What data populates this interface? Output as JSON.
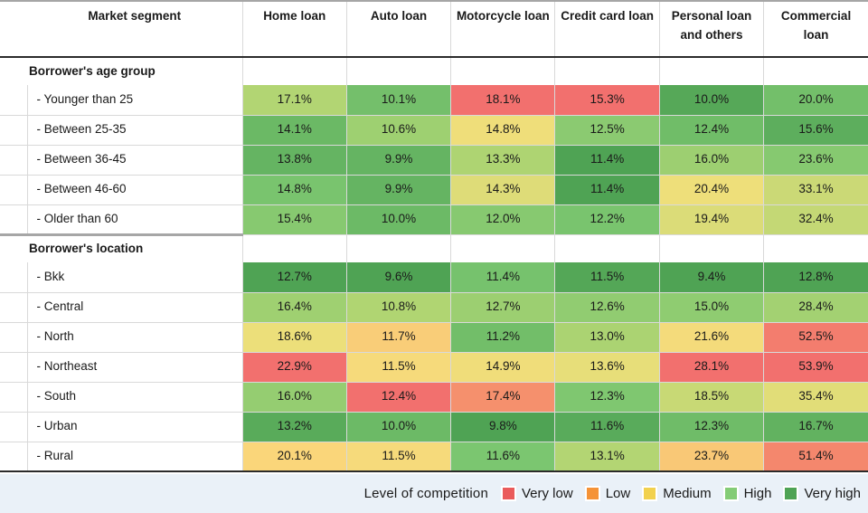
{
  "table": {
    "columns": [
      "Market segment",
      "Home loan",
      "Auto loan",
      "Motorcycle loan",
      "Credit card loan",
      "Personal loan and others",
      "Commercial loan"
    ],
    "sections": [
      {
        "title": "Borrower's age group",
        "rows": [
          {
            "label": "- Younger than 25",
            "values": [
              "17.1%",
              "10.1%",
              "18.1%",
              "15.3%",
              "10.0%",
              "20.0%"
            ]
          },
          {
            "label": "- Between 25-35",
            "values": [
              "14.1%",
              "10.6%",
              "14.8%",
              "12.5%",
              "12.4%",
              "15.6%"
            ]
          },
          {
            "label": "- Between 36-45",
            "values": [
              "13.8%",
              "9.9%",
              "13.3%",
              "11.4%",
              "16.0%",
              "23.6%"
            ]
          },
          {
            "label": "- Between 46-60",
            "values": [
              "14.8%",
              "9.9%",
              "14.3%",
              "11.4%",
              "20.4%",
              "33.1%"
            ]
          },
          {
            "label": "- Older than 60",
            "values": [
              "15.4%",
              "10.0%",
              "12.0%",
              "12.2%",
              "19.4%",
              "32.4%"
            ]
          }
        ]
      },
      {
        "title": "Borrower's location",
        "rows": [
          {
            "label": "- Bkk",
            "values": [
              "12.7%",
              "9.6%",
              "11.4%",
              "11.5%",
              "9.4%",
              "12.8%"
            ]
          },
          {
            "label": "- Central",
            "values": [
              "16.4%",
              "10.8%",
              "12.7%",
              "12.6%",
              "15.0%",
              "28.4%"
            ]
          },
          {
            "label": "- North",
            "values": [
              "18.6%",
              "11.7%",
              "11.2%",
              "13.0%",
              "21.6%",
              "52.5%"
            ]
          },
          {
            "label": "- Northeast",
            "values": [
              "22.9%",
              "11.5%",
              "14.9%",
              "13.6%",
              "28.1%",
              "53.9%"
            ]
          },
          {
            "label": "- South",
            "values": [
              "16.0%",
              "12.4%",
              "17.4%",
              "12.3%",
              "18.5%",
              "35.4%"
            ]
          },
          {
            "label": "- Urban",
            "values": [
              "13.2%",
              "10.0%",
              "9.8%",
              "11.6%",
              "12.3%",
              "16.7%"
            ]
          },
          {
            "label": "- Rural",
            "values": [
              "20.1%",
              "11.5%",
              "11.6%",
              "13.1%",
              "23.7%",
              "51.4%"
            ]
          }
        ]
      }
    ]
  },
  "chart_data": {
    "type": "heatmap",
    "title": "",
    "xlabel": "",
    "ylabel": "",
    "grid": true,
    "x_categories": [
      "Home loan",
      "Auto loan",
      "Motorcycle loan",
      "Credit card loan",
      "Personal loan and others",
      "Commercial loan"
    ],
    "y_categories": [
      "- Younger than 25",
      "- Between 25-35",
      "- Between 36-45",
      "- Between 46-60",
      "- Older than 60",
      "- Bkk",
      "- Central",
      "- North",
      "- Northeast",
      "- South",
      "- Urban",
      "- Rural"
    ],
    "y_groups": [
      {
        "name": "Borrower's age group",
        "members": [
          "- Younger than 25",
          "- Between 25-35",
          "- Between 36-45",
          "- Between 46-60",
          "- Older than 60"
        ]
      },
      {
        "name": "Borrower's location",
        "members": [
          "- Bkk",
          "- Central",
          "- North",
          "- Northeast",
          "- South",
          "- Urban",
          "- Rural"
        ]
      }
    ],
    "unit": "percent",
    "values": [
      [
        17.1,
        10.1,
        18.1,
        15.3,
        10.0,
        20.0
      ],
      [
        14.1,
        10.6,
        14.8,
        12.5,
        12.4,
        15.6
      ],
      [
        13.8,
        9.9,
        13.3,
        11.4,
        16.0,
        23.6
      ],
      [
        14.8,
        9.9,
        14.3,
        11.4,
        20.4,
        33.1
      ],
      [
        15.4,
        10.0,
        12.0,
        12.2,
        19.4,
        32.4
      ],
      [
        12.7,
        9.6,
        11.4,
        11.5,
        9.4,
        12.8
      ],
      [
        16.4,
        10.8,
        12.7,
        12.6,
        15.0,
        28.4
      ],
      [
        18.6,
        11.7,
        11.2,
        13.0,
        21.6,
        52.5
      ],
      [
        22.9,
        11.5,
        14.9,
        13.6,
        28.1,
        53.9
      ],
      [
        16.0,
        12.4,
        17.4,
        12.3,
        18.5,
        35.4
      ],
      [
        13.2,
        10.0,
        9.8,
        11.6,
        12.3,
        16.7
      ],
      [
        20.1,
        11.5,
        11.6,
        13.1,
        23.7,
        51.4
      ]
    ],
    "colorscale": {
      "direction": "low value = green (very high competition), high value = red (very low competition)",
      "normalization": "per-column min/max",
      "stops": [
        "#f2706e",
        "#f79c5e",
        "#f7d56b",
        "#a8d26d",
        "#4fa354"
      ]
    },
    "legend": {
      "position": "bottom-right",
      "title": "Level of competition",
      "entries": [
        {
          "label": "Very low",
          "color": "#ea5b5b"
        },
        {
          "label": "Low",
          "color": "#f59337"
        },
        {
          "label": "Medium",
          "color": "#f2d14e"
        },
        {
          "label": "High",
          "color": "#84cc76"
        },
        {
          "label": "Very high",
          "color": "#4fa354"
        }
      ]
    }
  },
  "legend": {
    "title": "Level of competition",
    "items": [
      {
        "label": "Very low",
        "color": "#ea5b5b"
      },
      {
        "label": "Low",
        "color": "#f59337"
      },
      {
        "label": "Medium",
        "color": "#f2d14e"
      },
      {
        "label": "High",
        "color": "#84cc76"
      },
      {
        "label": "Very high",
        "color": "#4fa354"
      }
    ]
  },
  "colors": {
    "footer_background": "#eaf1f8",
    "grid_line": "#d9d9d9",
    "rule_dark": "#2b2b2b",
    "rule_gray": "#a6a6a6"
  }
}
